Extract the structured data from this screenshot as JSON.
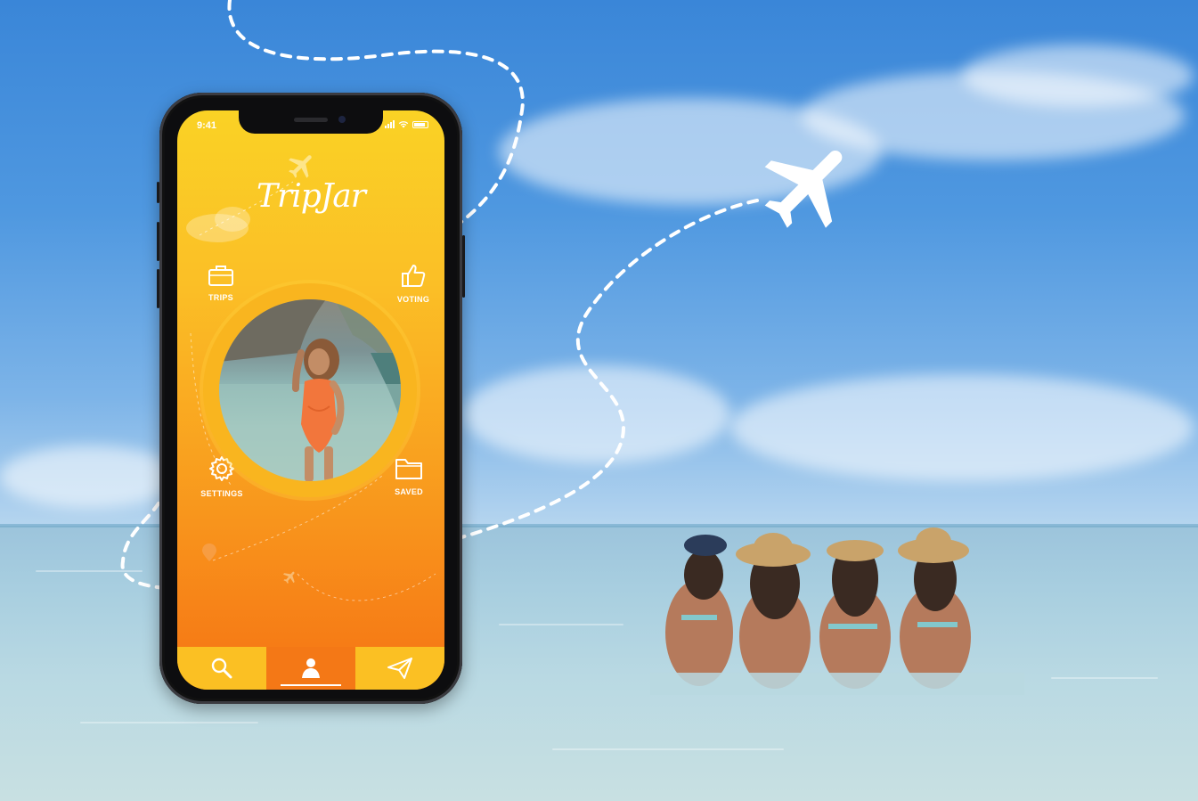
{
  "app": {
    "name": "TripJar"
  },
  "status_bar": {
    "time": "9:41"
  },
  "menu": {
    "trips": {
      "label": "TRIPS",
      "icon": "suitcase-icon"
    },
    "voting": {
      "label": "VOTING",
      "icon": "thumbs-up-icon"
    },
    "settings": {
      "label": "SETTINGS",
      "icon": "gear-icon"
    },
    "saved": {
      "label": "SAVED",
      "icon": "folder-icon"
    }
  },
  "tabbar": {
    "tabs": [
      {
        "icon": "search-icon",
        "active": false
      },
      {
        "icon": "profile-icon",
        "active": true
      },
      {
        "icon": "paper-plane-icon",
        "active": false
      }
    ]
  },
  "colors": {
    "screen_top": "#fad225",
    "screen_bottom": "#f57414",
    "active_tab": "#f47816",
    "tab": "#fbc023",
    "sky": "#3a86d8",
    "sea": "#a9cfe0"
  }
}
